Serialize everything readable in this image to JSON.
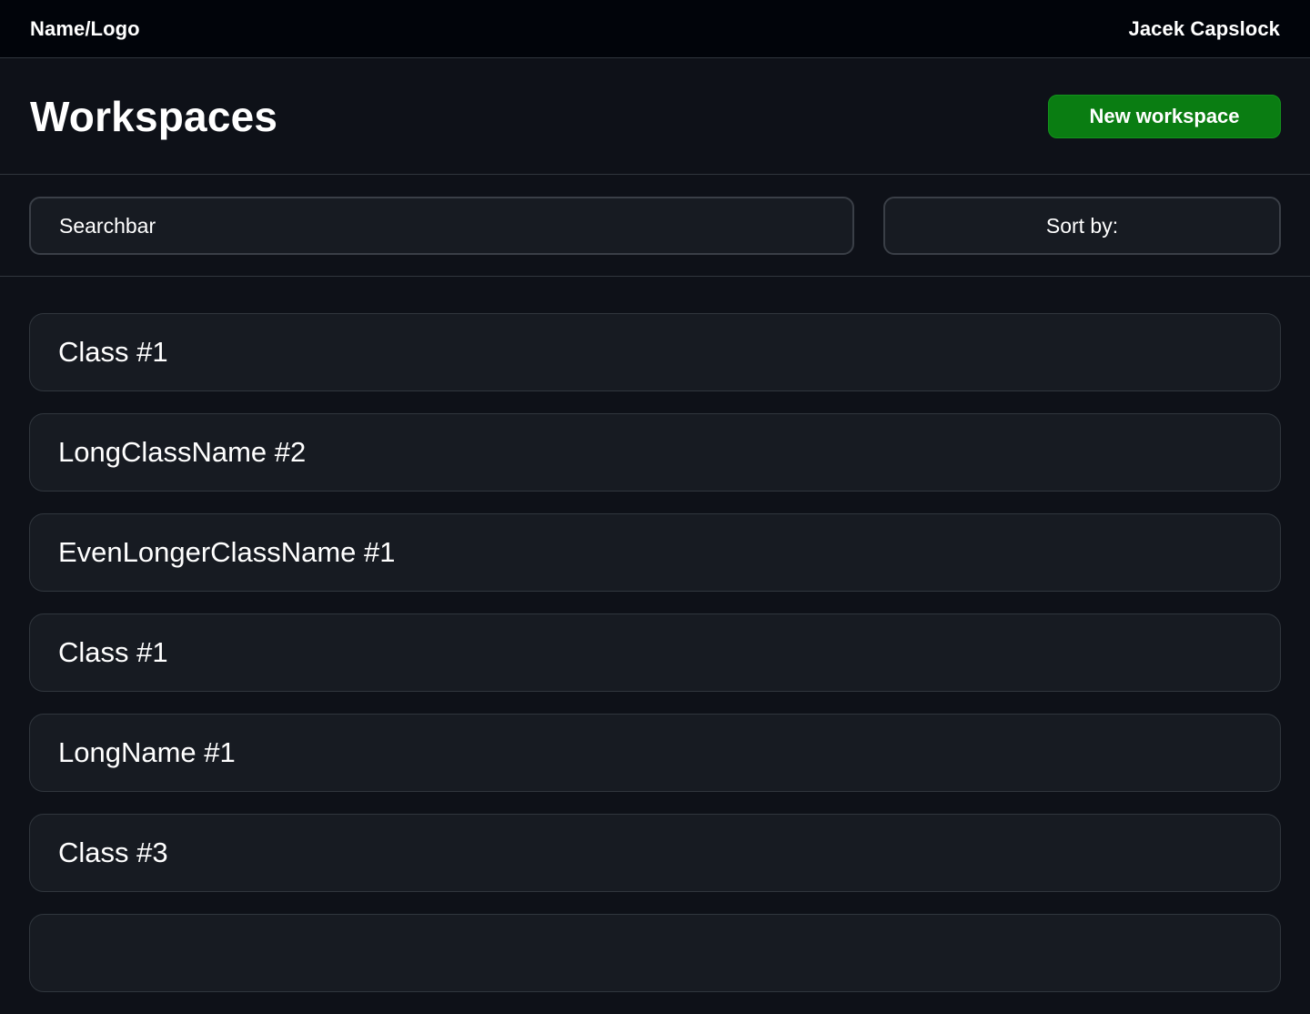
{
  "topbar": {
    "brand": "Name/Logo",
    "user": "Jacek Capslock"
  },
  "header": {
    "title": "Workspaces",
    "new_button_label": "New workspace"
  },
  "filters": {
    "search_placeholder": "Searchbar",
    "sort_label": "Sort by:"
  },
  "workspaces": [
    {
      "name": "Class #1"
    },
    {
      "name": "LongClassName #2"
    },
    {
      "name": "EvenLongerClassName #1"
    },
    {
      "name": "Class #1"
    },
    {
      "name": "LongName #1"
    },
    {
      "name": "Class #3"
    },
    {
      "name": ""
    }
  ],
  "colors": {
    "background": "#0e1118",
    "topbar": "#01040a",
    "card": "#171b22",
    "accent_green": "#0a7d12"
  }
}
